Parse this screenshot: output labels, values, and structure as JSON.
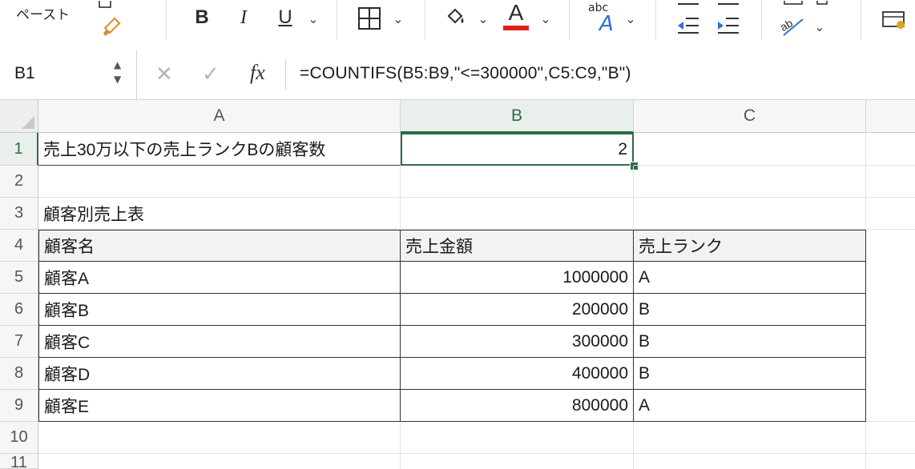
{
  "ribbon": {
    "paste_label": "ペースト",
    "bold": "B",
    "italic": "I",
    "underline": "U",
    "font_color_letter": "A",
    "font_color": "#e0201a",
    "abc_label": "abc",
    "abc_letter": "A"
  },
  "formula_bar": {
    "name_box": "B1",
    "fx": "fx",
    "formula": "=COUNTIFS(B5:B9,\"<=300000\",C5:C9,\"B\")"
  },
  "sheet": {
    "columns": [
      "A",
      "B",
      "C"
    ],
    "rows": [
      "1",
      "2",
      "3",
      "4",
      "5",
      "6",
      "7",
      "8",
      "9",
      "10",
      "11"
    ],
    "selected_cell": "B1",
    "accent": "#2e6b45",
    "a1": "売上30万以下の売上ランクBの顧客数",
    "b1": "2",
    "a3": "顧客別売上表",
    "table_header": [
      "顧客名",
      "売上金額",
      "売上ランク"
    ],
    "table_rows": [
      {
        "name": "顧客A",
        "amount": "1000000",
        "rank": "A"
      },
      {
        "name": "顧客B",
        "amount": "200000",
        "rank": "B"
      },
      {
        "name": "顧客C",
        "amount": "300000",
        "rank": "B"
      },
      {
        "name": "顧客D",
        "amount": "400000",
        "rank": "B"
      },
      {
        "name": "顧客E",
        "amount": "800000",
        "rank": "A"
      }
    ]
  }
}
